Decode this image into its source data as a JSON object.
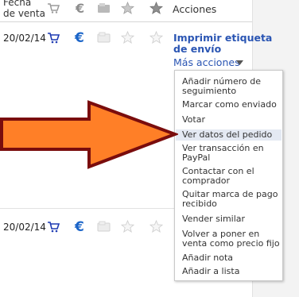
{
  "header": {
    "fecha_line1": "Fecha",
    "fecha_line2": "de venta",
    "acciones": "Acciones"
  },
  "rows": [
    {
      "date": "20/02/14",
      "primary_action_line1": "Imprimir etiqueta",
      "primary_action_line2": "de envío",
      "more_actions": "Más acciones"
    },
    {
      "date": "20/02/14"
    }
  ],
  "menu": {
    "items": [
      {
        "line1": "Añadir número de",
        "line2": "seguimiento"
      },
      {
        "line1": "Marcar como enviado"
      },
      {
        "line1": "Votar"
      },
      {
        "line1": "Ver datos del pedido"
      },
      {
        "line1": "Ver transacción en",
        "line2": "PayPal"
      },
      {
        "line1": "Contactar con el",
        "line2": "comprador"
      },
      {
        "line1": "Quitar marca de pago",
        "line2": "recibido"
      },
      {
        "line1": "Vender similar"
      },
      {
        "line1": "Volver a poner en",
        "line2": "venta como precio fijo"
      },
      {
        "line1": "Añadir nota"
      },
      {
        "line1": "Añadir a lista"
      }
    ]
  },
  "colors": {
    "link": "#2a55b3",
    "arrow_fill": "#ff7f27",
    "arrow_stroke": "#7a0d0d",
    "highlight": "#e4e9f3"
  },
  "icons": [
    "cart-icon",
    "euro-icon",
    "payment-icon",
    "feedback-star-icon",
    "sent-star-icon",
    "dropdown-triangle-icon"
  ]
}
